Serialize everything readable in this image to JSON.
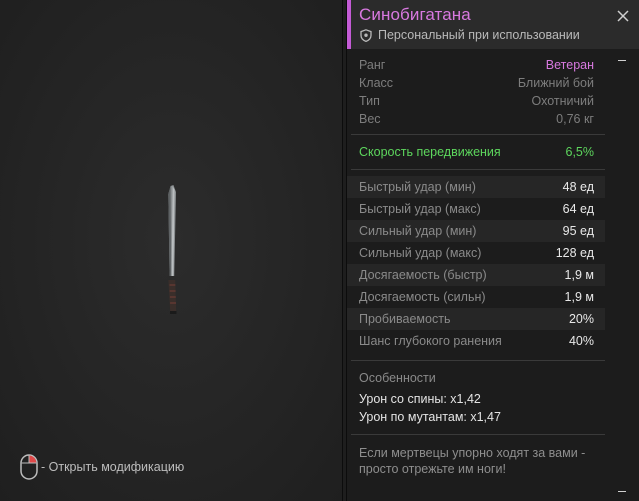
{
  "item": {
    "name": "Синобигатана",
    "binding": "Персональный при использовании"
  },
  "properties": [
    {
      "label": "Ранг",
      "value": "Ветеран"
    },
    {
      "label": "Класс",
      "value": "Ближний бой"
    },
    {
      "label": "Тип",
      "value": "Охотничий"
    },
    {
      "label": "Вес",
      "value": "0,76 кг"
    }
  ],
  "bonus": {
    "label": "Скорость передвижения",
    "value": "6,5%"
  },
  "stats": [
    {
      "label": "Быстрый удар (мин)",
      "value": "48 ед"
    },
    {
      "label": "Быстрый удар (макс)",
      "value": "64 ед"
    },
    {
      "label": "Сильный удар (мин)",
      "value": "95 ед"
    },
    {
      "label": "Сильный удар (макс)",
      "value": "128 ед"
    },
    {
      "label": "Досягаемость (быстр)",
      "value": "1,9 м"
    },
    {
      "label": "Досягаемость (сильн)",
      "value": "1,9 м"
    },
    {
      "label": "Пробиваемость",
      "value": "20%"
    },
    {
      "label": "Шанс глубокого ранения",
      "value": "40%"
    }
  ],
  "features": {
    "heading": "Особенности",
    "lines": [
      "Урон со спины: x1,42",
      "Урон по мутантам: x1,47"
    ]
  },
  "description": [
    "Если мертвецы упорно ходят за вами -",
    "просто отрежьте им ноги!"
  ],
  "hint": {
    "text": "- Открыть модификацию"
  },
  "colors": {
    "rarity": "#d879e0",
    "bonus": "#5dd65d"
  }
}
